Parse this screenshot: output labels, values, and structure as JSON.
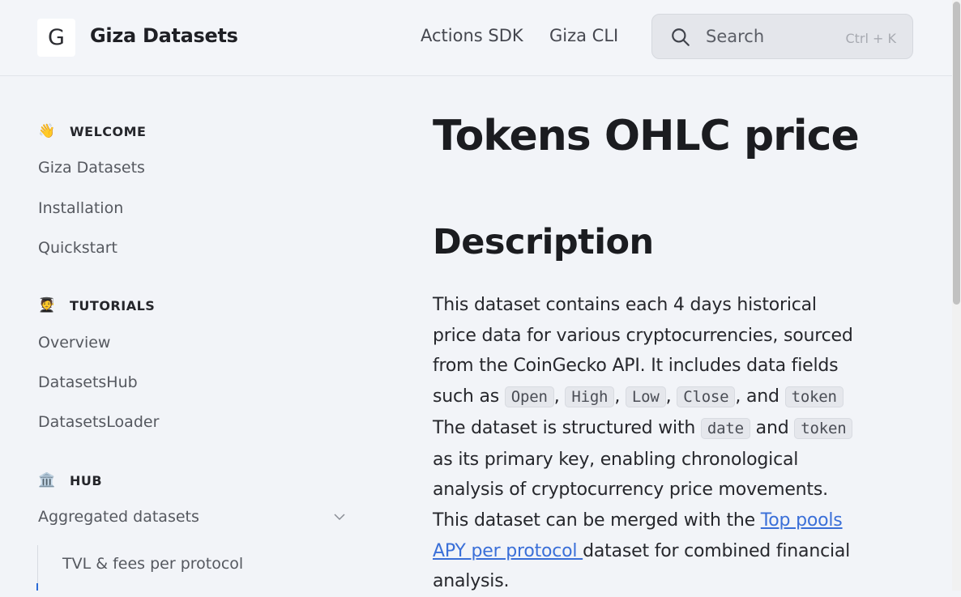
{
  "header": {
    "logo_letter": "G",
    "brand": "Giza Datasets",
    "nav": [
      "Actions SDK",
      "Giza CLI"
    ],
    "search": {
      "placeholder": "Search",
      "shortcut": "Ctrl + K"
    }
  },
  "sidebar": {
    "sections": [
      {
        "emoji": "👋",
        "title": "WELCOME",
        "items": [
          "Giza Datasets",
          "Installation",
          "Quickstart"
        ]
      },
      {
        "emoji": "🧑‍🎓",
        "title": "TUTORIALS",
        "items": [
          "Overview",
          "DatasetsHub",
          "DatasetsLoader"
        ]
      },
      {
        "emoji": "🏛️",
        "title": "HUB",
        "items": [
          "Aggregated datasets"
        ]
      }
    ],
    "subitems": [
      "TVL & fees per protocol"
    ]
  },
  "content": {
    "title": "Tokens OHLC price",
    "section_heading": "Description",
    "para": {
      "t1": "This dataset contains each 4 days historical price data for various cryptocurrencies, sourced from the CoinGecko API. It includes data fields such as ",
      "c_open": "Open",
      "sep1": ", ",
      "c_high": "High",
      "sep2": ", ",
      "c_low": "Low",
      "sep3": ", ",
      "c_close": "Close",
      "t2": ", and ",
      "c_token": "token",
      "t3": " The dataset is structured with ",
      "c_date": "date",
      "t4": " and ",
      "c_token2": "token",
      "t5": " as its primary key, enabling chronological analysis of cryptocurrency price movements. This dataset can be merged with the ",
      "link": "Top pools APY per protocol ",
      "t6": "dataset for combined financial analysis."
    }
  }
}
